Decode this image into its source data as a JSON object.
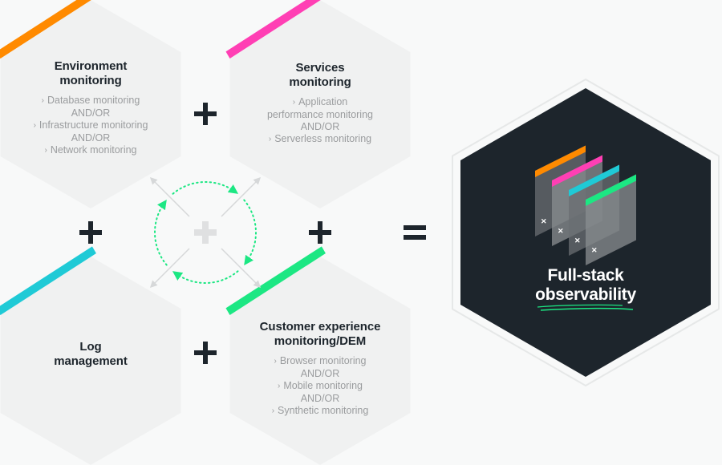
{
  "diagram": {
    "colors": {
      "background": "#f8f9f9",
      "hex_fill": "#f0f1f1",
      "dark_hex": "#1d252c",
      "operator": "#1d252c",
      "orange": "#ff8a00",
      "pink": "#ff3fb4",
      "cyan": "#1fcad6",
      "green": "#1ce783",
      "subtext": "#9a9c9e"
    },
    "hexagons": [
      {
        "id": "environment",
        "accent": "orange",
        "title_lines": [
          "Environment",
          "monitoring"
        ],
        "items": [
          {
            "type": "bullet",
            "text": "Database monitoring"
          },
          {
            "type": "connector",
            "text": "AND/OR"
          },
          {
            "type": "bullet",
            "text": "Infrastructure monitoring"
          },
          {
            "type": "connector",
            "text": "AND/OR"
          },
          {
            "type": "bullet",
            "text": "Network monitoring"
          }
        ]
      },
      {
        "id": "services",
        "accent": "pink",
        "title_lines": [
          "Services",
          "monitoring"
        ],
        "items": [
          {
            "type": "bullet",
            "text": "Application"
          },
          {
            "type": "continuation",
            "text": "performance monitoring"
          },
          {
            "type": "connector",
            "text": "AND/OR"
          },
          {
            "type": "bullet",
            "text": "Serverless monitoring"
          }
        ]
      },
      {
        "id": "log",
        "accent": "cyan",
        "title_lines": [
          "Log",
          "management"
        ],
        "items": []
      },
      {
        "id": "customer",
        "accent": "green",
        "title_lines": [
          "Customer experience",
          "monitoring/DEM"
        ],
        "items": [
          {
            "type": "bullet",
            "text": "Browser monitoring"
          },
          {
            "type": "connector",
            "text": "AND/OR"
          },
          {
            "type": "bullet",
            "text": "Mobile monitoring"
          },
          {
            "type": "connector",
            "text": "AND/OR"
          },
          {
            "type": "bullet",
            "text": "Synthetic monitoring"
          }
        ]
      }
    ],
    "operators": {
      "plus_symbol": "+",
      "equals_symbol": "="
    },
    "result": {
      "title_lines": [
        "Full-stack",
        "observability"
      ],
      "layer_colors": [
        "orange",
        "pink",
        "cyan",
        "green"
      ],
      "layer_close_glyph": "✕"
    },
    "bullet_glyph": "›"
  }
}
